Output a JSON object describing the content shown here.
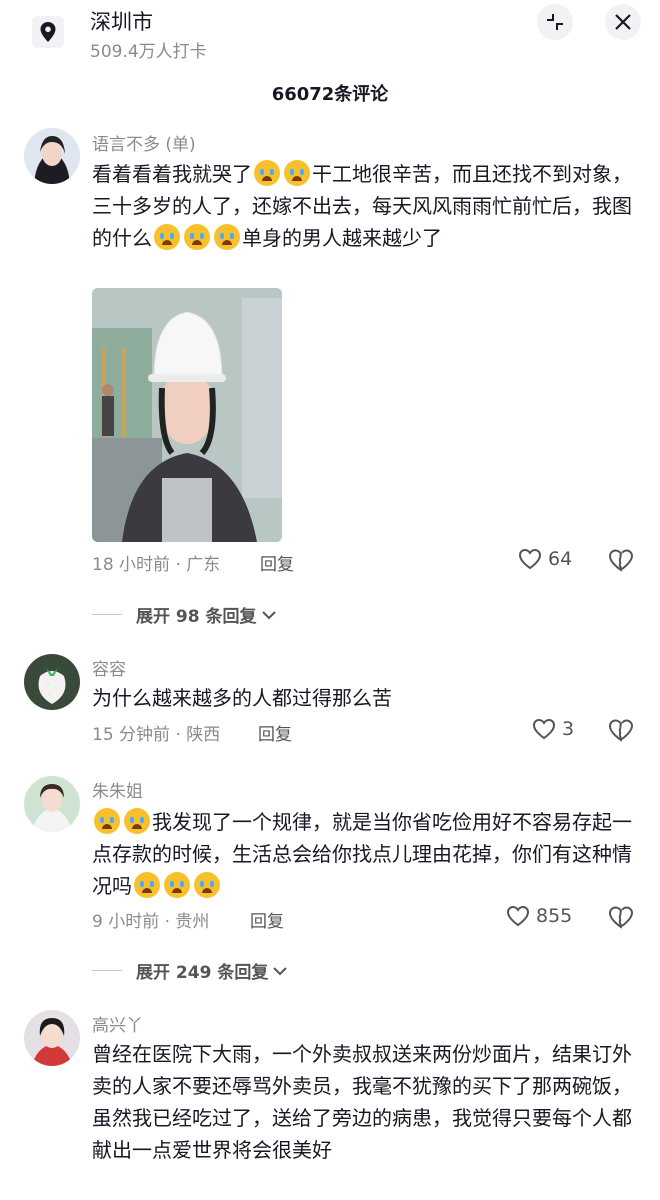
{
  "location": {
    "city": "深圳市",
    "checkins": "509.4万人打卡"
  },
  "comments_header": "66072条评论",
  "comments": [
    {
      "user": "语言不多 (单)",
      "text_parts": [
        "看着看着我就哭了",
        "干工地很辛苦，而且还找不到对象，三十多岁的人了，还嫁不出去，每天风风雨雨忙前忙后，我图的什么",
        "单身的男人越来越少了"
      ],
      "time_loc": "18 小时前 · 广东",
      "reply": "回复",
      "likes": "64",
      "expand": "展开 98 条回复"
    },
    {
      "user": "容容",
      "text": "为什么越来越多的人都过得那么苦",
      "time_loc": "15 分钟前 · 陕西",
      "reply": "回复",
      "likes": "3"
    },
    {
      "user": "朱朱姐",
      "text_parts": [
        "我发现了一个规律，就是当你省吃俭用好不容易存起一点存款的时候，生活总会给你找点儿理由花掉，你们有这种情况吗"
      ],
      "time_loc": "9 小时前 · 贵州",
      "reply": "回复",
      "likes": "855",
      "expand": "展开 249 条回复"
    },
    {
      "user": "高兴丫",
      "text": "曾经在医院下大雨，一个外卖叔叔送来两份炒面片，结果订外卖的人家不要还辱骂外卖员，我毫不犹豫的买下了那两碗饭，虽然我已经吃过了，送给了旁边的病患，我觉得只要每个人都献出一点爱世界将会很美好"
    }
  ],
  "icons": {
    "location": "location-pin-icon",
    "collapse": "collapse-icon",
    "close": "close-icon",
    "like": "heart-outline-icon",
    "dislike": "broken-heart-icon",
    "chevron": "chevron-down-icon",
    "emoji": "crying-emoji-icon"
  },
  "colors": {
    "text": "#161823",
    "secondary": "#8a8b91",
    "emoji": "#f7c02c"
  }
}
